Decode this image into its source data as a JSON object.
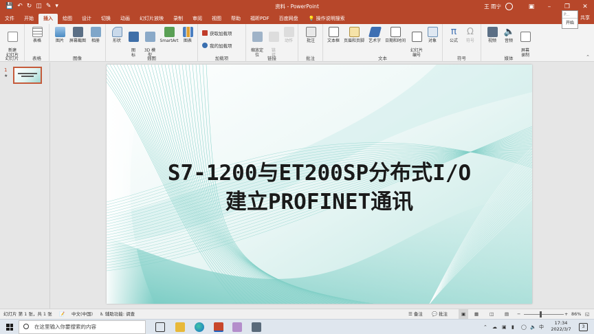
{
  "titlebar": {
    "doc_title": "资料 - PowerPoint",
    "user_name": "王 雨宁",
    "qat": [
      "save-icon",
      "undo-icon",
      "redo-icon",
      "present-icon",
      "pen-icon",
      "more-icon"
    ]
  },
  "tabs": [
    "文件",
    "开始",
    "插入",
    "绘图",
    "设计",
    "切换",
    "动画",
    "幻灯片放映",
    "录制",
    "审阅",
    "视图",
    "帮助",
    "福昕PDF",
    "百度网盘"
  ],
  "active_tab": "插入",
  "tell_me": "操作说明搜索",
  "share_label": "共享",
  "tooltip": {
    "top": "P...",
    "label": "开始"
  },
  "ribbon": {
    "new_slide": "新建\n幻灯片",
    "group_slides": "幻灯片",
    "table": "表格",
    "group_tables": "表格",
    "picture": "图片",
    "screenshot": "屏幕截图",
    "album": "相册",
    "group_images": "图像",
    "shapes": "形状",
    "icons": "图\n标",
    "model3d": "3D 模\n型",
    "smartart": "SmartArt",
    "chart": "图表",
    "group_illustrations": "插图",
    "get_addins": "获取加载项",
    "my_addins": "我的加载项",
    "group_addins": "加载项",
    "zoom": "缩放定\n位",
    "link": "链\n接",
    "action": "动作",
    "group_links": "链接",
    "comment": "批注",
    "group_comments": "批注",
    "textbox": "文本框",
    "header_footer": "页眉和页脚",
    "wordart": "艺术字",
    "datetime": "日期和时间",
    "slide_number": "幻灯片\n编号",
    "object": "对象",
    "group_text": "文本",
    "equation": "公式",
    "symbol": "符号",
    "group_symbols": "符号",
    "video": "视频",
    "audio": "音频",
    "screen_record": "屏幕\n录制",
    "group_media": "媒体"
  },
  "thumbs": {
    "number": "1",
    "star": "★"
  },
  "slide": {
    "title_line1": "S7-1200与ET200SP分布式I/O",
    "title_line2": "建立PROFINET通讯"
  },
  "statusbar": {
    "slide_info": "幻灯片 第 1 张，共 1 张",
    "language": "中文(中国)",
    "accessibility": "辅助功能: 调查",
    "notes": "备注",
    "comments": "批注",
    "zoom_minus": "−",
    "zoom_plus": "+",
    "zoom_level": "86%",
    "zoom_fraction": 0.43
  },
  "taskbar": {
    "search_placeholder": "在这里输入你要搜索的内容",
    "time": "17:34",
    "date": "2022/3/7",
    "ime": "中",
    "notifications": "3"
  },
  "colors": {
    "brand": "#b7472a",
    "slide_teal": "#8fd3cc"
  }
}
